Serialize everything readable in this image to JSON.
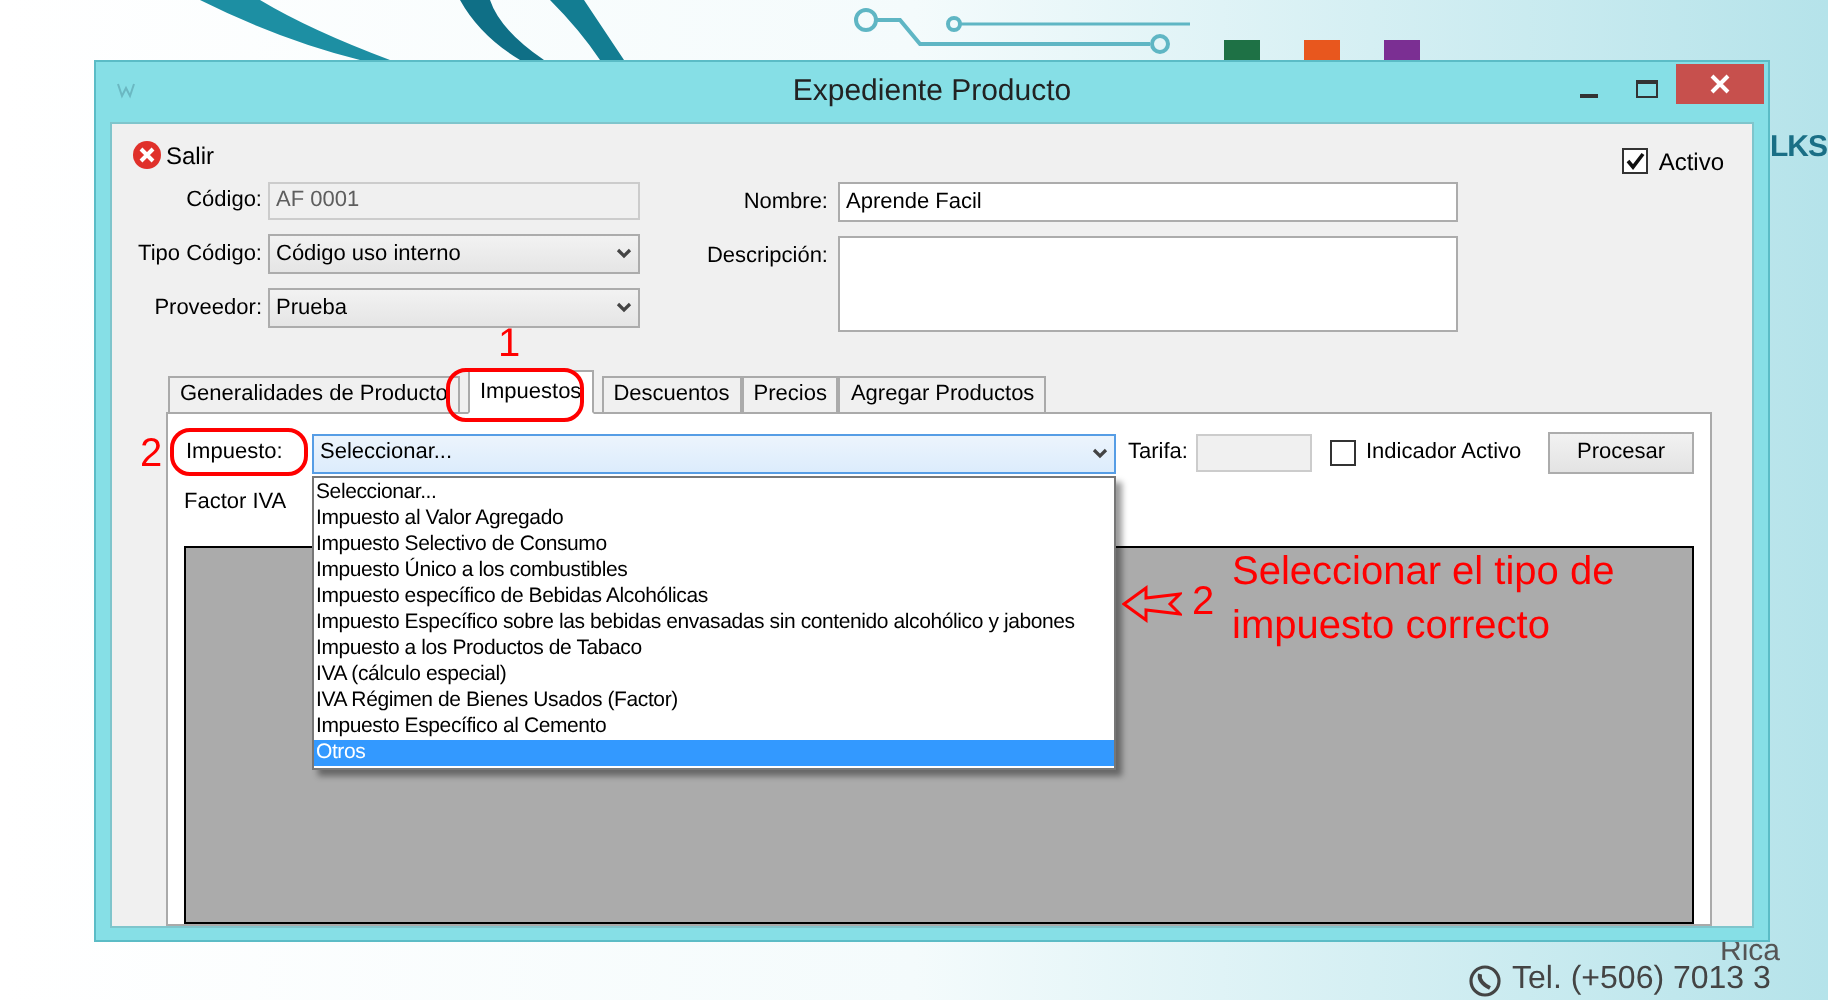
{
  "desktop": {
    "texts": [
      "LKS",
      "Rica",
      "Tel. (+506) 7013 3"
    ]
  },
  "window": {
    "title": "Expediente Producto"
  },
  "toolbar": {
    "exit_label": "Salir"
  },
  "active": {
    "label": "Activo",
    "checked": true
  },
  "left_fields": [
    {
      "label": "Código:",
      "value": "AF 0001",
      "kind": "readonly"
    },
    {
      "label": "Tipo Código:",
      "value": "Código uso interno",
      "kind": "dropdown"
    },
    {
      "label": "Proveedor:",
      "value": "Prueba",
      "kind": "dropdown"
    }
  ],
  "right_fields": [
    {
      "label": "Nombre:",
      "value": "Aprende Facil",
      "kind": "text"
    },
    {
      "label": "Descripción:",
      "kind": "textarea"
    }
  ],
  "tabs": [
    {
      "label": "Generalidades de Producto",
      "selected": false
    },
    {
      "label": "Impuestos",
      "selected": true
    },
    {
      "label": "Descuentos",
      "selected": false
    },
    {
      "label": "Precios",
      "selected": false
    },
    {
      "label": "Agregar Productos",
      "selected": false
    }
  ],
  "tax_panel": {
    "tax_label": "Impuesto:",
    "tax_value": "Seleccionar...",
    "rate_label": "Tarifa:",
    "indicator": {
      "label": "Indicador Activo",
      "checked": false
    },
    "process_button": "Procesar",
    "factor_label": "Factor IVA"
  },
  "dropdown": {
    "options": [
      {
        "label": "Seleccionar...",
        "selected": false
      },
      {
        "label": "Impuesto al Valor Agregado",
        "selected": false
      },
      {
        "label": "Impuesto Selectivo de Consumo",
        "selected": false
      },
      {
        "label": "Impuesto Único a los combustibles",
        "selected": false
      },
      {
        "label": "Impuesto específico de Bebidas Alcohólicas",
        "selected": false
      },
      {
        "label": "Impuesto Específico sobre las bebidas envasadas sin contenido alcohólico y jabones",
        "selected": false
      },
      {
        "label": "Impuesto a los Productos de Tabaco",
        "selected": false
      },
      {
        "label": "IVA (cálculo especial)",
        "selected": false
      },
      {
        "label": "IVA Régimen de Bienes Usados (Factor)",
        "selected": false
      },
      {
        "label": "Impuesto Específico al Cemento",
        "selected": false
      },
      {
        "label": "Otros",
        "selected": true
      }
    ]
  },
  "annotations": {
    "tab_step": "1",
    "field_step": "2",
    "arrow_step": "2",
    "note": "Seleccionar el tipo de impuesto correcto"
  }
}
